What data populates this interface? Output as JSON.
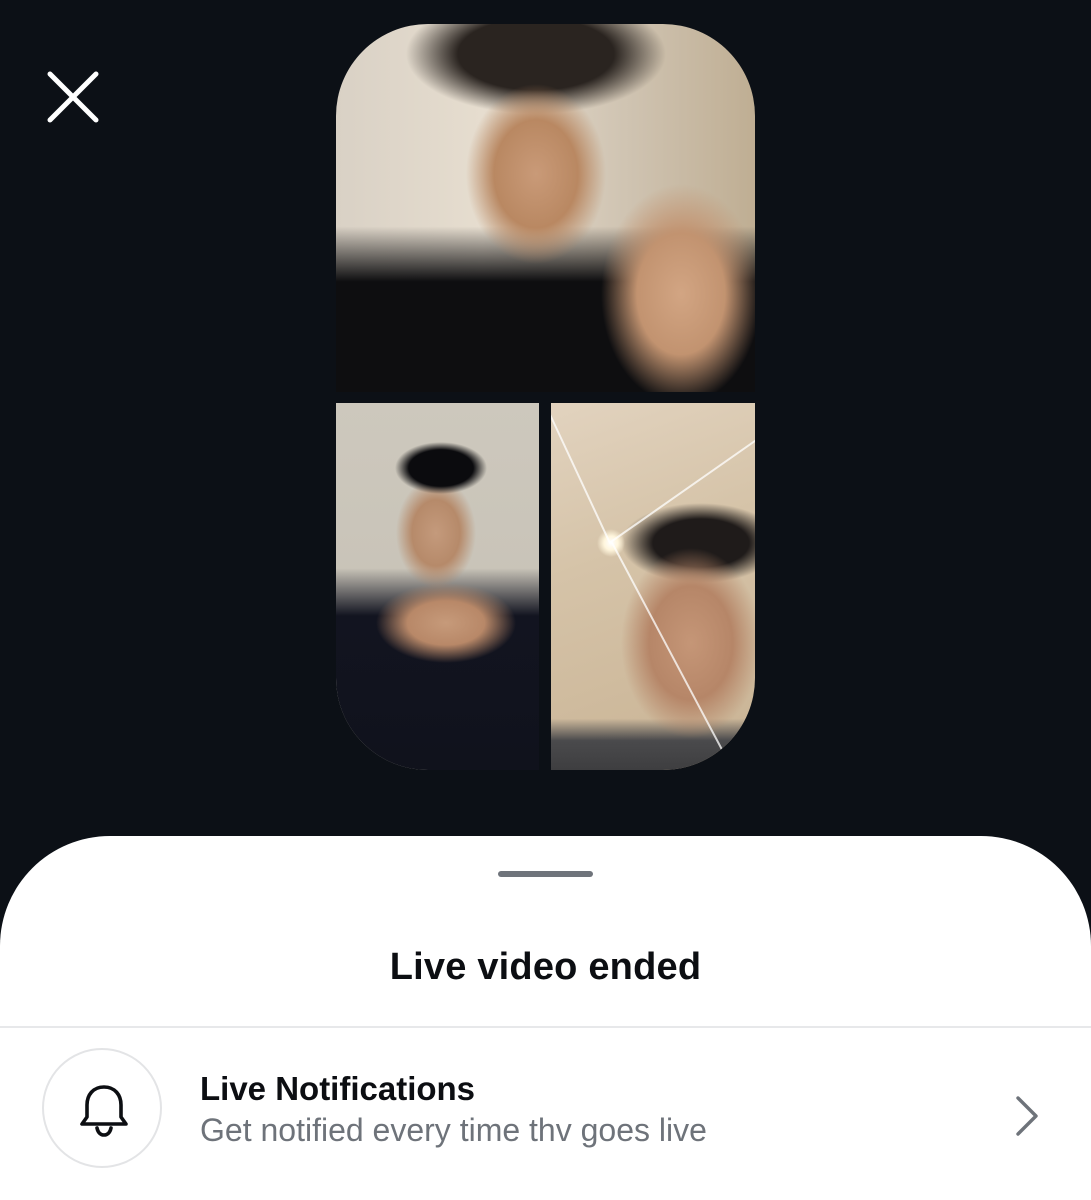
{
  "header": {
    "close_icon": "close-icon"
  },
  "live_collage": {
    "tiles": [
      {
        "role": "host-video"
      },
      {
        "role": "guest-video-left"
      },
      {
        "role": "guest-video-right"
      }
    ]
  },
  "sheet": {
    "title": "Live video ended",
    "notifications": {
      "icon": "bell-icon",
      "title": "Live Notifications",
      "subtitle": "Get notified every time thv goes live",
      "chevron_icon": "chevron-right-icon"
    }
  },
  "colors": {
    "background": "#0c1016",
    "sheet": "#ffffff",
    "text_primary": "#0c0e12",
    "text_secondary": "#6e737a"
  }
}
